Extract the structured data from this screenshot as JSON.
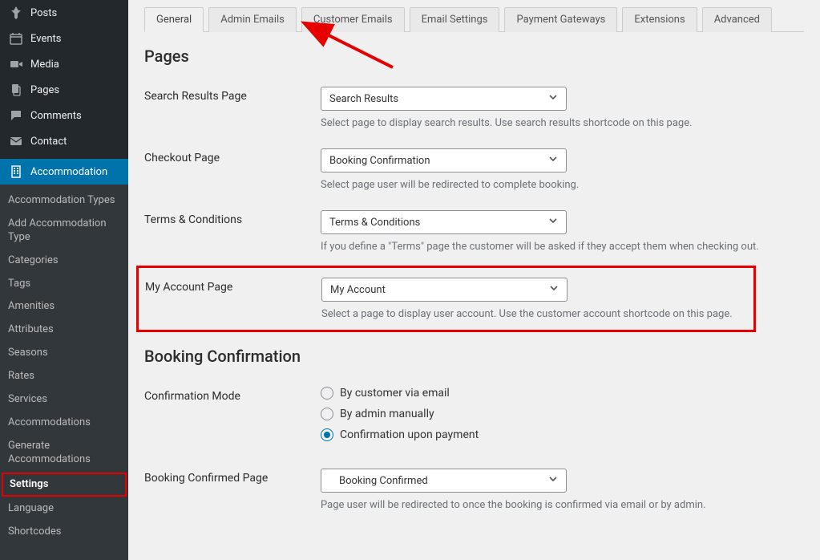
{
  "sidebar": {
    "top": [
      {
        "label": "Posts",
        "icon": "pin"
      },
      {
        "label": "Events",
        "icon": "calendar"
      },
      {
        "label": "Media",
        "icon": "media"
      },
      {
        "label": "Pages",
        "icon": "pages"
      },
      {
        "label": "Comments",
        "icon": "comment"
      },
      {
        "label": "Contact",
        "icon": "mail"
      },
      {
        "label": "Accommodation",
        "icon": "building"
      }
    ],
    "sub": [
      "Accommodation Types",
      "Add Accommodation Type",
      "Categories",
      "Tags",
      "Amenities",
      "Attributes",
      "Seasons",
      "Rates",
      "Services",
      "Accommodations",
      "Generate Accommodations",
      "Settings",
      "Language",
      "Shortcodes"
    ],
    "activeSub": "Settings"
  },
  "tabs": [
    "General",
    "Admin Emails",
    "Customer Emails",
    "Email Settings",
    "Payment Gateways",
    "Extensions",
    "Advanced"
  ],
  "activeTab": "General",
  "sections": {
    "pages": {
      "title": "Pages",
      "search": {
        "label": "Search Results Page",
        "value": "Search Results",
        "help": "Select page to display search results. Use search results shortcode on this page."
      },
      "checkout": {
        "label": "Checkout Page",
        "value": "Booking Confirmation",
        "help": "Select page user will be redirected to complete booking."
      },
      "terms": {
        "label": "Terms & Conditions",
        "value": "Terms & Conditions",
        "help": "If you define a \"Terms\" page the customer will be asked if they accept them when checking out."
      },
      "account": {
        "label": "My Account Page",
        "value": "My Account",
        "help": "Select a page to display user account. Use the customer account shortcode on this page."
      }
    },
    "booking": {
      "title": "Booking Confirmation",
      "modeLabel": "Confirmation Mode",
      "options": [
        "By customer via email",
        "By admin manually",
        "Confirmation upon payment"
      ],
      "selected": 2,
      "confirmed": {
        "label": "Booking Confirmed Page",
        "value": "Booking Confirmed",
        "help": "Page user will be redirected to once the booking is confirmed via email or by admin."
      }
    }
  }
}
